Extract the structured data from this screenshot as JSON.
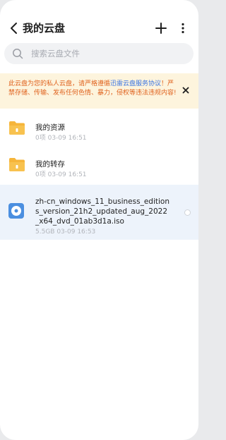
{
  "header": {
    "title": "我的云盘",
    "icons": [
      "back-icon",
      "add-icon",
      "more-icon"
    ]
  },
  "search": {
    "placeholder": "搜索云盘文件"
  },
  "notice": {
    "text_before": "此云盘为您的私人云盘，请严格遵循",
    "link": "迅雷云盘服务协议",
    "text_after": "！严禁存储、传输、发布任何色情、暴力，侵权等违法违规内容!"
  },
  "files": [
    {
      "name": "我的资源",
      "meta": "0项  03-09 16:51",
      "icon": "folder-icon"
    },
    {
      "name": "我的转存",
      "meta": "0项  03-09 16:51",
      "icon": "folder-icon"
    },
    {
      "name": "zh-cn_windows_11_business_editions_version_21h2_updated_aug_2022_x64_dvd_01ab3d1a.iso",
      "meta": "5.5GB  03-09 16:53",
      "icon": "iso-disc-icon"
    }
  ],
  "colors": {
    "accent": "#3a74e2",
    "notice_bg": "#fdf4dd",
    "notice_text": "#e0631f",
    "folder": "#f6b53a",
    "selected_row": "#edf3fb"
  }
}
